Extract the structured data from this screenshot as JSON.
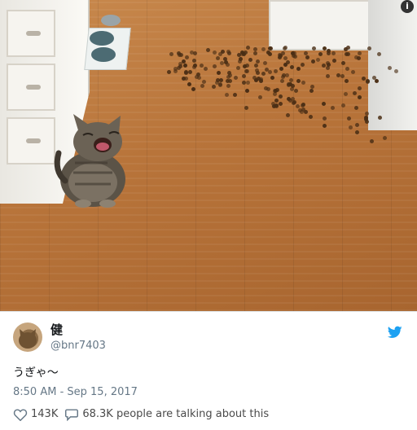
{
  "photo": {
    "alt_subject": "cat with spilled food",
    "info_icon": "i"
  },
  "tweet": {
    "display_name": "健",
    "handle": "@bnr7403",
    "text": "うぎゃ〜",
    "timestamp": "8:50 AM - Sep 15, 2017",
    "likes": "143K",
    "talking": "68.3K people are talking about this",
    "brand_color": "#1da1f2",
    "icons": {
      "like": "heart-icon",
      "talk": "comment-icon",
      "brand": "twitter-bird-icon"
    }
  }
}
